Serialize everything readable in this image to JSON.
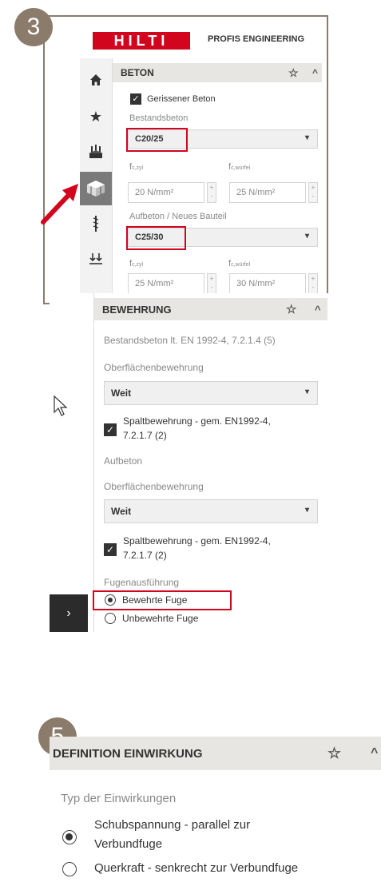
{
  "steps": {
    "step_three": "3",
    "step_five": "5"
  },
  "header": {
    "logo_text": "HILTI",
    "app_title": "PROFIS ENGINEERING"
  },
  "sidebar": {
    "icons": [
      "home-icon",
      "star-icon",
      "anchor-plate-icon",
      "concrete-block-icon",
      "rebar-icon",
      "loads-icon"
    ],
    "active_index": 3,
    "expand_label": "›"
  },
  "beton": {
    "title": "BETON",
    "cracked_label": "Gerissener Beton",
    "cracked_checked": true,
    "existing_label": "Bestandsbeton",
    "existing_value": "C20/25",
    "fc_zyl_label": "f",
    "fc_zyl_sub": "c,zyl",
    "fc_wuerfel_label": "f",
    "fc_wuerfel_sub": "c,würfel",
    "existing_fc_zyl": "20 N/mm²",
    "existing_fc_wuerfel": "25 N/mm²",
    "new_label": "Aufbeton / Neues Bauteil",
    "new_value": "C25/30",
    "new_fc_zyl": "25 N/mm²",
    "new_fc_wuerfel": "30 N/mm²",
    "stepper_plus": "+",
    "stepper_minus": "-"
  },
  "bewehrung": {
    "title": "BEWEHRUNG",
    "norm_text": "Bestandsbeton lt. EN 1992-4, 7.2.1.4 (5)",
    "surface_label_1": "Oberflächenbewehrung",
    "surface_value_1": "Weit",
    "split_label_1a": "Spaltbewehrung - gem. EN1992-4,",
    "split_label_1b": "7.2.1.7 (2)",
    "aufbeton_label": "Aufbeton",
    "surface_label_2": "Oberflächenbewehrung",
    "surface_value_2": "Weit",
    "split_label_2a": "Spaltbewehrung - gem. EN1992-4,",
    "split_label_2b": "7.2.1.7 (2)",
    "joint_label": "Fugenausführung",
    "joint_options": [
      "Bewehrte Fuge",
      "Unbewehrte Fuge"
    ],
    "joint_selected": 0
  },
  "einwirkung": {
    "title": "DEFINITION EINWIRKUNG",
    "type_label": "Typ der Einwirkungen",
    "option_1a": "Schubspannung - parallel zur",
    "option_1b": "Verbundfuge",
    "option_2": "Querkraft - senkrecht zur Verbundfuge",
    "selected": 0
  },
  "colors": {
    "brand_red": "#d2051e",
    "badge": "#8b7b6b",
    "section_header": "#e8e6e3"
  },
  "glyphs": {
    "star": "☆",
    "chevron_up": "^",
    "caret_down": "▾",
    "check": "✓"
  }
}
